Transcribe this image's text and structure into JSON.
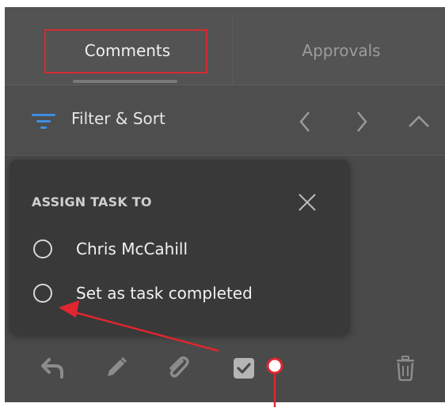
{
  "tabs": {
    "comments_label": "Comments",
    "approvals_label": "Approvals"
  },
  "filter": {
    "label": "Filter & Sort",
    "icons": [
      "filter-icon",
      "chevron-left-icon",
      "chevron-right-icon",
      "chevron-up-icon"
    ]
  },
  "popup": {
    "title": "ASSIGN TASK TO",
    "options": [
      {
        "label": "Chris McCahill",
        "selected": false
      },
      {
        "label": "Set as task completed",
        "selected": false
      }
    ]
  },
  "toolbar": {
    "icons": [
      "reply-icon",
      "edit-icon",
      "attach-icon",
      "task-checkbox-icon",
      "delete-icon"
    ]
  },
  "colors": {
    "panel_bg": "#4a4a4a",
    "popup_bg": "#393939",
    "accent_blue": "#3d8fe0",
    "annotation_red": "#e0262f"
  }
}
